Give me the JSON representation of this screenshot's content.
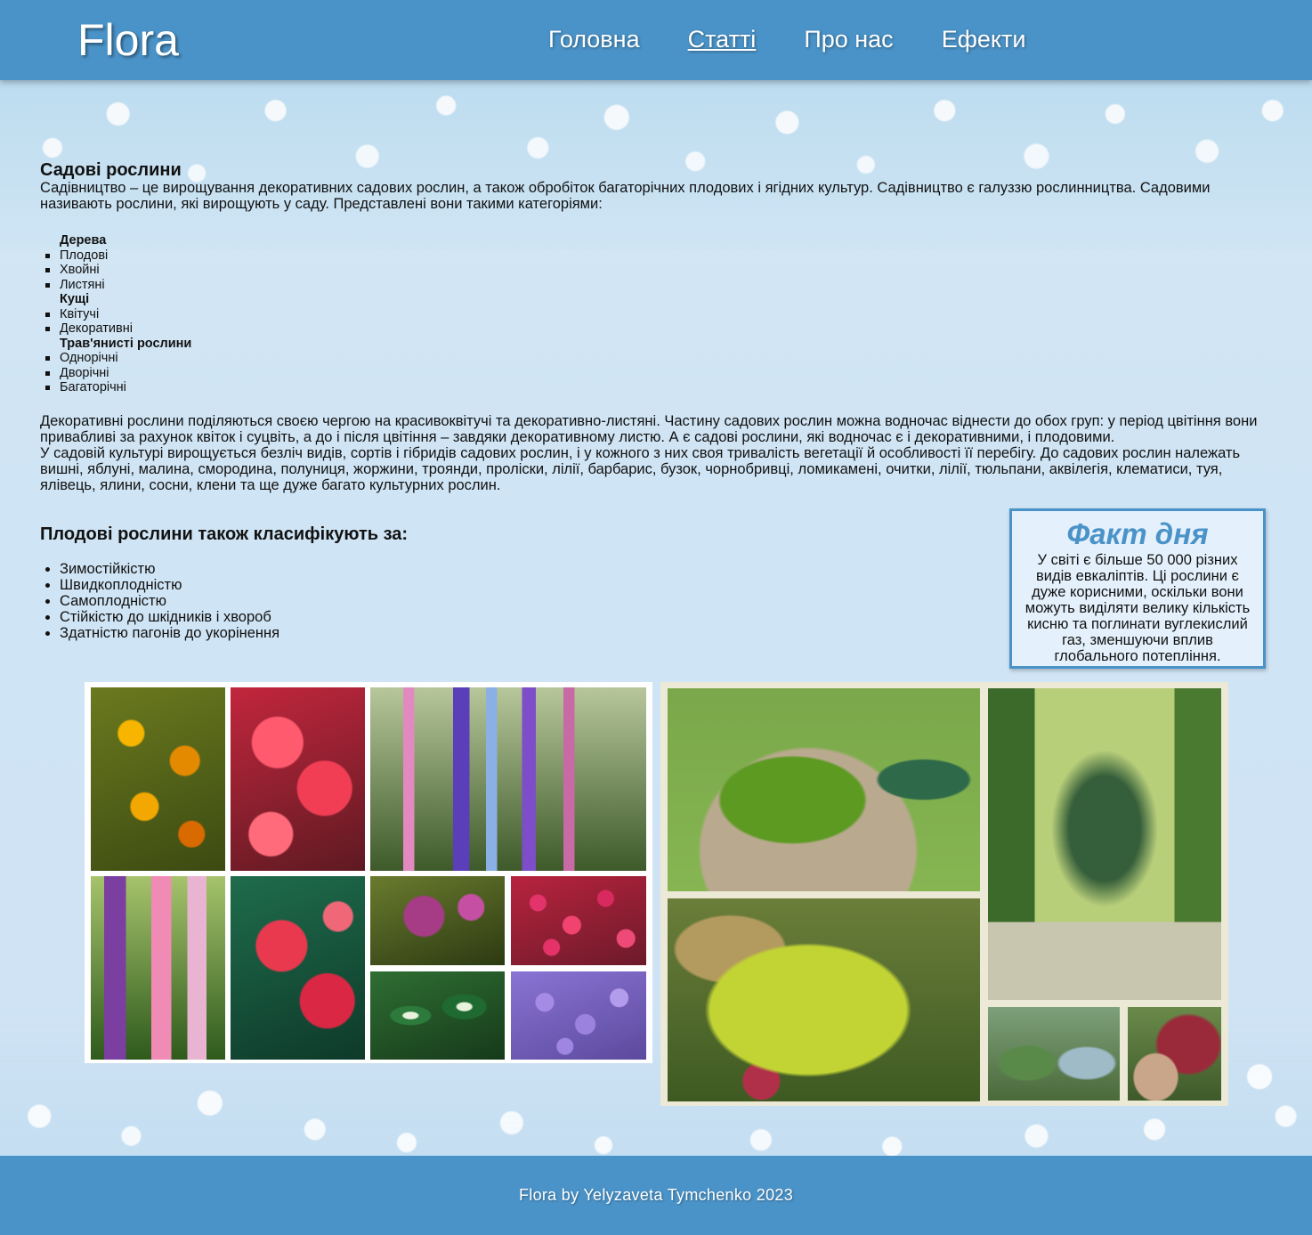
{
  "header": {
    "logo": "Flora",
    "nav": [
      {
        "label": "Головна"
      },
      {
        "label": "Статті",
        "active": true
      },
      {
        "label": "Про нас"
      },
      {
        "label": "Ефекти"
      }
    ]
  },
  "main": {
    "title": "Садові рослини",
    "intro": "Садівництво – це вирощування декоративних садових рослин, а також обробіток багаторічних плодових і ягідних культур. Садівництво є галуззю рослинництва. Садовими називають рослини, які вирощують у саду. Представлені вони такими категоріями:",
    "categories": [
      {
        "group": "Дерева",
        "items": [
          "Плодові",
          "Хвойні",
          "Листяні"
        ]
      },
      {
        "group": "Кущі",
        "items": [
          "Квітучі",
          "Декоративні"
        ]
      },
      {
        "group": "Трав'янисті рослини",
        "items": [
          "Однорічні",
          "Дворічні",
          "Багаторічні"
        ]
      }
    ],
    "paragraph1": "Декоративні рослини поділяються своєю чергою на красивоквітучі та декоративно-листяні. Частину садових рослин можна водночас віднести до обох груп: у період цвітіння вони привабливі за рахунок квіток і суцвіть, а до і після цвітіння – завдяки декоративному листю. А є садові рослини, які водночас є і декоративними, і плодовими.",
    "paragraph2": "У садовій культурі вирощується безліч видів, сортів і гібридів садових рослин, і у кожного з них своя тривалість вегетації й особливості її перебігу. До садових рослин належать вишні, яблуні, малина, смородина, полуниця, жоржини, троянди, проліски, лілії, барбарис, бузок, чорнобривці, ломикамені, очитки, лілії, тюльпани, аквілегія, клематиси, туя, ялівець, ялини, сосни, клени та ще дуже багато культурних рослин.",
    "subtitle": "Плодові рослини також класифікують за:",
    "classify": [
      "Зимостійкістю",
      "Швидкоплодністю",
      "Самоплодністю",
      "Стійкістю до шкідників і хвороб",
      "Здатністю пагонів до укорінення"
    ]
  },
  "fact": {
    "title": "Факт дня",
    "text": "У світі є більше 50 000 різних видів евкаліптів. Ці рослини є дуже корисними, оскільки вони можуть виділяти велику кількість кисню та поглинати вуглекислий газ, зменшуючи вплив глобального потепління."
  },
  "footer": {
    "text": "Flora by Yelyzaveta Tymchenko 2023"
  },
  "colors": {
    "header_bg": "#4a93c8",
    "page_bg": "#cfe4f4",
    "fact_title": "#4a93c8"
  }
}
